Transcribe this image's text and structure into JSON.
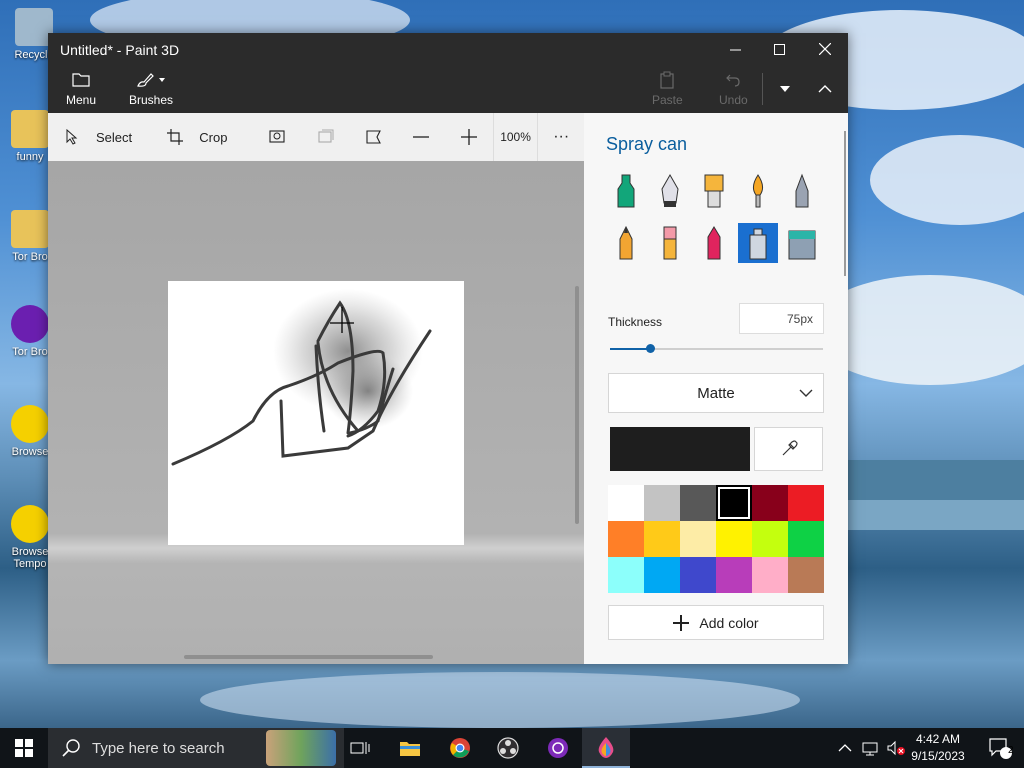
{
  "desktop": {
    "icons": [
      {
        "label": "Recycle",
        "color": "#9fb8cc"
      },
      {
        "label": "funny",
        "color": "#e8c35a"
      },
      {
        "label": "Tor Bro",
        "color": "#e8c35a"
      },
      {
        "label": "Tor Bro",
        "color": "#6b1fb0"
      },
      {
        "label": "Browse",
        "color": "#f5d000"
      },
      {
        "label": "Browse Tempo",
        "color": "#f5d000"
      }
    ]
  },
  "window": {
    "title": "Untitled* - Paint 3D",
    "menu_label": "Menu",
    "brushes_label": "Brushes",
    "paste_label": "Paste",
    "undo_label": "Undo"
  },
  "toolbar": {
    "select_label": "Select",
    "crop_label": "Crop",
    "zoom": "100%",
    "more": "···"
  },
  "panel": {
    "title": "Spray can",
    "brushes": [
      "marker-icon",
      "calligraphy-pen-icon",
      "oil-brush-icon",
      "watercolor-icon",
      "pixel-pen-icon",
      "pencil-icon",
      "eraser-icon",
      "crayon-icon",
      "spray-can-icon",
      "fill-icon"
    ],
    "selected_brush": "spray-can-icon",
    "thickness_label": "Thickness",
    "thickness_value": "75px",
    "thickness_fraction": 0.19,
    "finish": "Matte",
    "current_color": "#1e1e1e",
    "swatches": [
      "#ffffff",
      "#c3c3c3",
      "#585858",
      "#000000",
      "#88001b",
      "#ec1c24",
      "#ff7f27",
      "#ffca18",
      "#fdeca6",
      "#fff200",
      "#c4ff0e",
      "#0ed145",
      "#8cfffb",
      "#00a8f3",
      "#3f48cc",
      "#b83dba",
      "#ffaec8",
      "#b97a56"
    ],
    "selected_swatch": 3,
    "add_color": "Add color"
  },
  "taskbar": {
    "search_placeholder": "Type here to search",
    "time": "4:42 AM",
    "date": "9/15/2023",
    "notifications": "2"
  }
}
